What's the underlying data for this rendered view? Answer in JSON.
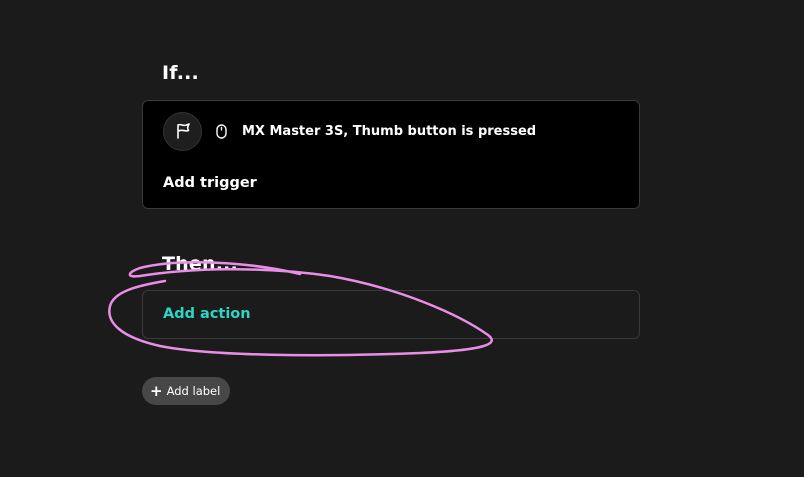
{
  "if_section": {
    "heading": "If...",
    "trigger": {
      "flag_icon": "flag-icon",
      "device_icon": "mouse-icon",
      "text": "MX Master 3S, Thumb button is pressed"
    },
    "add_trigger_label": "Add trigger"
  },
  "then_section": {
    "heading": "Then...",
    "add_action_label": "Add action"
  },
  "add_label_button": {
    "icon": "plus-icon",
    "label": "Add label"
  },
  "colors": {
    "background": "#1b1b1b",
    "card": "#000000",
    "accent": "#2dd5c4",
    "annotation": "#e98ee6"
  }
}
